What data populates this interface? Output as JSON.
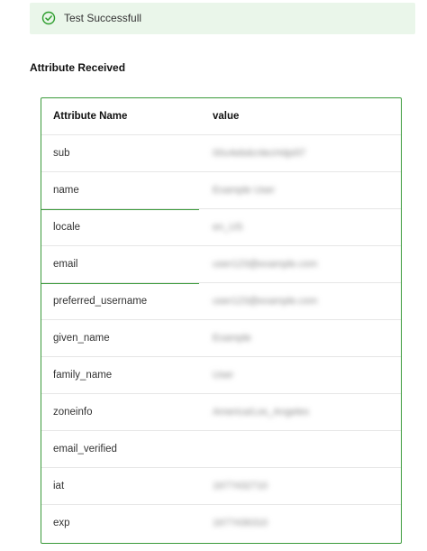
{
  "banner": {
    "message": "Test Successfull",
    "icon": "check-circle-icon",
    "color": "#eaf6ea",
    "icon_color": "#2e9e2e"
  },
  "section_title": "Attribute Received",
  "table": {
    "columns": [
      "Attribute Name",
      "value"
    ],
    "rows": [
      {
        "name": "sub",
        "value": "00u4ebdcnlecHdp0l7"
      },
      {
        "name": "name",
        "value": "Example User"
      },
      {
        "name": "locale",
        "value": "en_US"
      },
      {
        "name": "email",
        "value": "user123@example.com"
      },
      {
        "name": "preferred_username",
        "value": "user123@example.com"
      },
      {
        "name": "given_name",
        "value": "Example"
      },
      {
        "name": "family_name",
        "value": "User"
      },
      {
        "name": "zoneinfo",
        "value": "America/Los_Angeles"
      },
      {
        "name": "email_verified",
        "value": ""
      },
      {
        "name": "iat",
        "value": "1677432710"
      },
      {
        "name": "exp",
        "value": "1677436310"
      }
    ]
  }
}
